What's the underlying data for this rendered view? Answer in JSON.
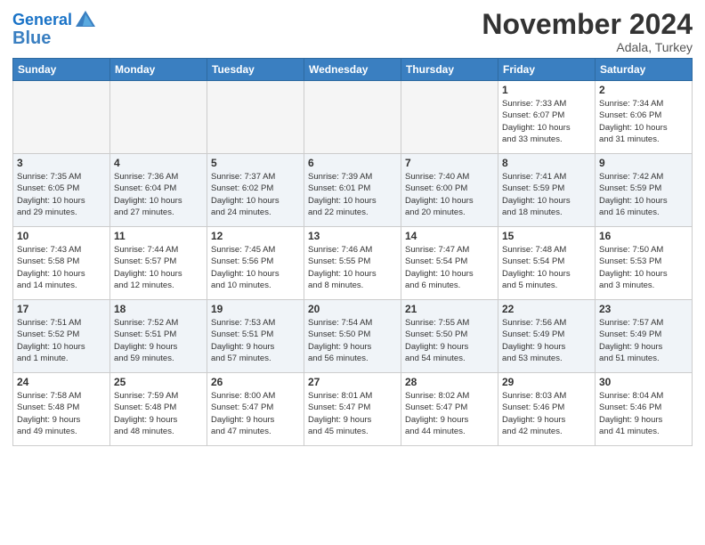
{
  "header": {
    "logo_line1": "General",
    "logo_line2": "Blue",
    "month": "November 2024",
    "location": "Adala, Turkey"
  },
  "weekdays": [
    "Sunday",
    "Monday",
    "Tuesday",
    "Wednesday",
    "Thursday",
    "Friday",
    "Saturday"
  ],
  "weeks": [
    [
      {
        "day": "",
        "info": ""
      },
      {
        "day": "",
        "info": ""
      },
      {
        "day": "",
        "info": ""
      },
      {
        "day": "",
        "info": ""
      },
      {
        "day": "",
        "info": ""
      },
      {
        "day": "1",
        "info": "Sunrise: 7:33 AM\nSunset: 6:07 PM\nDaylight: 10 hours\nand 33 minutes."
      },
      {
        "day": "2",
        "info": "Sunrise: 7:34 AM\nSunset: 6:06 PM\nDaylight: 10 hours\nand 31 minutes."
      }
    ],
    [
      {
        "day": "3",
        "info": "Sunrise: 7:35 AM\nSunset: 6:05 PM\nDaylight: 10 hours\nand 29 minutes."
      },
      {
        "day": "4",
        "info": "Sunrise: 7:36 AM\nSunset: 6:04 PM\nDaylight: 10 hours\nand 27 minutes."
      },
      {
        "day": "5",
        "info": "Sunrise: 7:37 AM\nSunset: 6:02 PM\nDaylight: 10 hours\nand 24 minutes."
      },
      {
        "day": "6",
        "info": "Sunrise: 7:39 AM\nSunset: 6:01 PM\nDaylight: 10 hours\nand 22 minutes."
      },
      {
        "day": "7",
        "info": "Sunrise: 7:40 AM\nSunset: 6:00 PM\nDaylight: 10 hours\nand 20 minutes."
      },
      {
        "day": "8",
        "info": "Sunrise: 7:41 AM\nSunset: 5:59 PM\nDaylight: 10 hours\nand 18 minutes."
      },
      {
        "day": "9",
        "info": "Sunrise: 7:42 AM\nSunset: 5:59 PM\nDaylight: 10 hours\nand 16 minutes."
      }
    ],
    [
      {
        "day": "10",
        "info": "Sunrise: 7:43 AM\nSunset: 5:58 PM\nDaylight: 10 hours\nand 14 minutes."
      },
      {
        "day": "11",
        "info": "Sunrise: 7:44 AM\nSunset: 5:57 PM\nDaylight: 10 hours\nand 12 minutes."
      },
      {
        "day": "12",
        "info": "Sunrise: 7:45 AM\nSunset: 5:56 PM\nDaylight: 10 hours\nand 10 minutes."
      },
      {
        "day": "13",
        "info": "Sunrise: 7:46 AM\nSunset: 5:55 PM\nDaylight: 10 hours\nand 8 minutes."
      },
      {
        "day": "14",
        "info": "Sunrise: 7:47 AM\nSunset: 5:54 PM\nDaylight: 10 hours\nand 6 minutes."
      },
      {
        "day": "15",
        "info": "Sunrise: 7:48 AM\nSunset: 5:54 PM\nDaylight: 10 hours\nand 5 minutes."
      },
      {
        "day": "16",
        "info": "Sunrise: 7:50 AM\nSunset: 5:53 PM\nDaylight: 10 hours\nand 3 minutes."
      }
    ],
    [
      {
        "day": "17",
        "info": "Sunrise: 7:51 AM\nSunset: 5:52 PM\nDaylight: 10 hours\nand 1 minute."
      },
      {
        "day": "18",
        "info": "Sunrise: 7:52 AM\nSunset: 5:51 PM\nDaylight: 9 hours\nand 59 minutes."
      },
      {
        "day": "19",
        "info": "Sunrise: 7:53 AM\nSunset: 5:51 PM\nDaylight: 9 hours\nand 57 minutes."
      },
      {
        "day": "20",
        "info": "Sunrise: 7:54 AM\nSunset: 5:50 PM\nDaylight: 9 hours\nand 56 minutes."
      },
      {
        "day": "21",
        "info": "Sunrise: 7:55 AM\nSunset: 5:50 PM\nDaylight: 9 hours\nand 54 minutes."
      },
      {
        "day": "22",
        "info": "Sunrise: 7:56 AM\nSunset: 5:49 PM\nDaylight: 9 hours\nand 53 minutes."
      },
      {
        "day": "23",
        "info": "Sunrise: 7:57 AM\nSunset: 5:49 PM\nDaylight: 9 hours\nand 51 minutes."
      }
    ],
    [
      {
        "day": "24",
        "info": "Sunrise: 7:58 AM\nSunset: 5:48 PM\nDaylight: 9 hours\nand 49 minutes."
      },
      {
        "day": "25",
        "info": "Sunrise: 7:59 AM\nSunset: 5:48 PM\nDaylight: 9 hours\nand 48 minutes."
      },
      {
        "day": "26",
        "info": "Sunrise: 8:00 AM\nSunset: 5:47 PM\nDaylight: 9 hours\nand 47 minutes."
      },
      {
        "day": "27",
        "info": "Sunrise: 8:01 AM\nSunset: 5:47 PM\nDaylight: 9 hours\nand 45 minutes."
      },
      {
        "day": "28",
        "info": "Sunrise: 8:02 AM\nSunset: 5:47 PM\nDaylight: 9 hours\nand 44 minutes."
      },
      {
        "day": "29",
        "info": "Sunrise: 8:03 AM\nSunset: 5:46 PM\nDaylight: 9 hours\nand 42 minutes."
      },
      {
        "day": "30",
        "info": "Sunrise: 8:04 AM\nSunset: 5:46 PM\nDaylight: 9 hours\nand 41 minutes."
      }
    ]
  ]
}
